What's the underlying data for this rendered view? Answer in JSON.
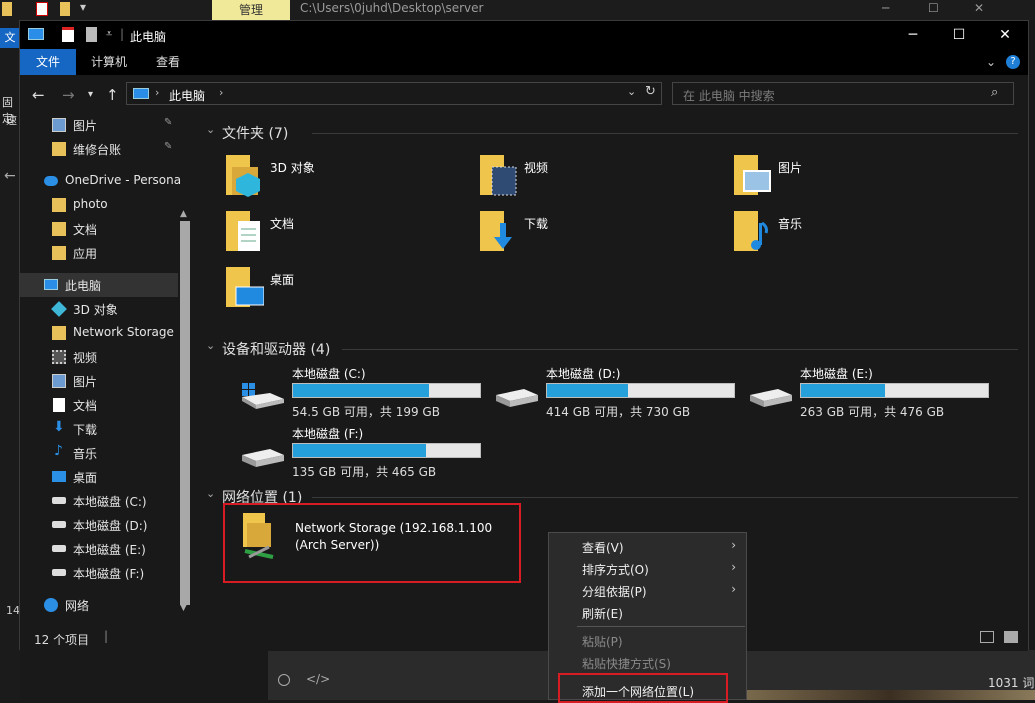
{
  "outer": {
    "tab": "管理",
    "path": "C:\\Users\\0juhd\\Desktop\\server",
    "left_fragments": [
      "文",
      "固定",
      "速",
      "14"
    ],
    "editor_status": "1031 词"
  },
  "window": {
    "title": "此电脑",
    "controls": {
      "minimize": "─",
      "maximize": "☐",
      "close": "✕"
    }
  },
  "ribbon": {
    "tabs": [
      "文件",
      "计算机",
      "查看"
    ]
  },
  "address": {
    "breadcrumb": "此电脑",
    "search_placeholder": "在 此电脑 中搜索"
  },
  "nav_pane": {
    "items": [
      {
        "label": "图片",
        "pinned": true
      },
      {
        "label": "维修台账",
        "pinned": true
      },
      {
        "label": "OneDrive - Persona"
      },
      {
        "label": "photo"
      },
      {
        "label": "文档"
      },
      {
        "label": "应用"
      },
      {
        "label": "此电脑",
        "selected": true
      },
      {
        "label": "3D 对象"
      },
      {
        "label": "Network Storage ("
      },
      {
        "label": "视频"
      },
      {
        "label": "图片"
      },
      {
        "label": "文档"
      },
      {
        "label": "下载"
      },
      {
        "label": "音乐"
      },
      {
        "label": "桌面"
      },
      {
        "label": "本地磁盘 (C:)"
      },
      {
        "label": "本地磁盘 (D:)"
      },
      {
        "label": "本地磁盘 (E:)"
      },
      {
        "label": "本地磁盘 (F:)"
      },
      {
        "label": "网络"
      }
    ]
  },
  "content": {
    "folders_header": "文件夹 (7)",
    "folders": [
      "3D 对象",
      "视频",
      "图片",
      "文档",
      "下载",
      "音乐",
      "桌面"
    ],
    "drives_header": "设备和驱动器 (4)",
    "drives": [
      {
        "name": "本地磁盘 (C:)",
        "free": "54.5 GB 可用，共 199 GB",
        "used_fraction": 0.726
      },
      {
        "name": "本地磁盘 (D:)",
        "free": "414 GB 可用，共 730 GB",
        "used_fraction": 0.433
      },
      {
        "name": "本地磁盘 (E:)",
        "free": "263 GB 可用，共 476 GB",
        "used_fraction": 0.447
      },
      {
        "name": "本地磁盘 (F:)",
        "free": "135 GB 可用，共 465 GB",
        "used_fraction": 0.71
      }
    ],
    "network_header": "网络位置 (1)",
    "network": {
      "line1": "Network Storage (192.168.1.100",
      "line2": "(Arch Server))"
    }
  },
  "status": {
    "count": "12 个项目"
  },
  "context_menu": {
    "items": [
      {
        "label": "查看(V)",
        "submenu": true
      },
      {
        "label": "排序方式(O)",
        "submenu": true
      },
      {
        "label": "分组依据(P)",
        "submenu": true
      },
      {
        "label": "刷新(E)"
      },
      {
        "label": "粘贴(P)",
        "disabled": true
      },
      {
        "label": "粘贴快捷方式(S)",
        "disabled": true
      },
      {
        "label": "添加一个网络位置(L)"
      }
    ]
  },
  "colors": {
    "accent": "#1667c4",
    "highlight_box": "#d71c24",
    "drive_fill": "#26a0da"
  }
}
